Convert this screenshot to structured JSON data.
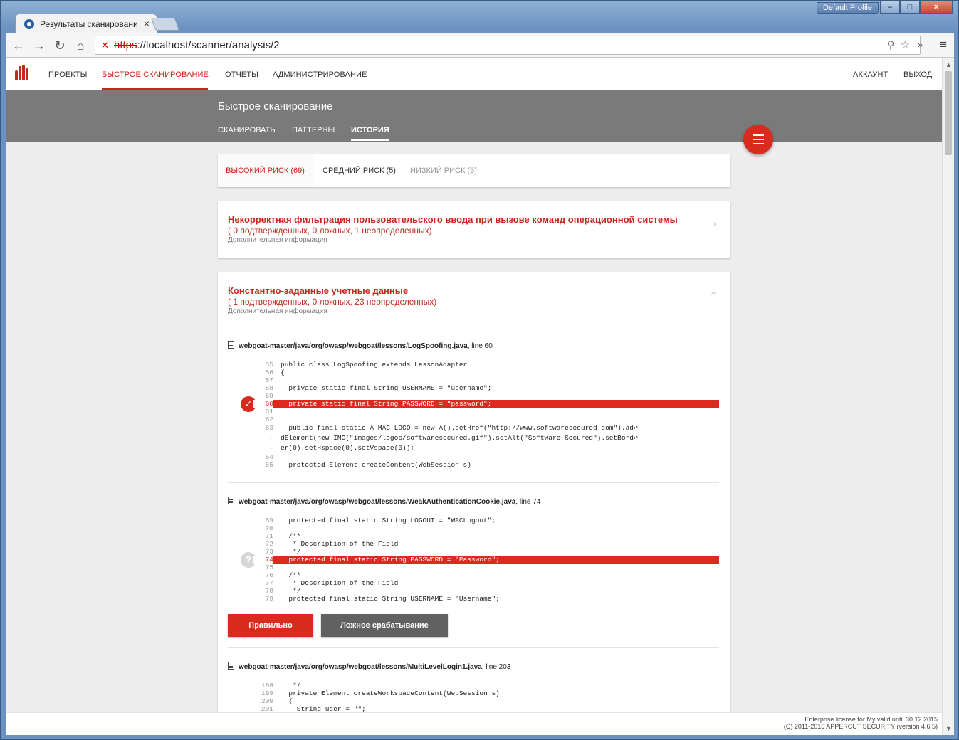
{
  "browser": {
    "tab_title": "Результаты сканировани",
    "tab_close": "×",
    "profile": "Default Profile",
    "win_min": "–",
    "win_max": "□",
    "win_close": "×",
    "url_scheme": "https",
    "url_rest": "://localhost/scanner/analysis/2",
    "back": "←",
    "forward": "→",
    "reload": "↻",
    "home": "⌂",
    "more": "»",
    "menu": "≡",
    "omni_icons": "⚲☆"
  },
  "nav": {
    "items": [
      "ПРОЕКТЫ",
      "БЫСТРОЕ СКАНИРОВАНИЕ",
      "ОТЧЕТЫ",
      "АДМИНИСТРИРОВАНИЕ"
    ],
    "account": "АККАУНТ",
    "logout": "ВЫХОД"
  },
  "subheader": {
    "title": "Быстрое сканирование",
    "tabs": [
      "СКАНИРОВАТЬ",
      "ПАТТЕРНЫ",
      "ИСТОРИЯ"
    ]
  },
  "risk_tabs": {
    "high": "ВЫСОКИЙ РИСК (69)",
    "medium": "СРЕДНИЙ РИСК (5)",
    "low": "НИЗКИЙ РИСК (3)"
  },
  "vulns": [
    {
      "title": "Некорректная фильтрация пользовательского ввода при вызове команд операционной системы",
      "counts": "( 0 подтвержденных, 0 ложных, 1 неопределенных)",
      "more": "Дополнительная информация",
      "chevron": "›"
    },
    {
      "title": "Константно-заданные учетные данные",
      "counts": "( 1 подтвержденных, 0 ложных, 23 неопределенных)",
      "more": "Дополнительная информация",
      "chevron": "‹",
      "findings": [
        {
          "path": "webgoat-master/java/org/owasp/webgoat/lessons/LogSpoofing.java",
          "line_label": ", line 60",
          "mark": "✓",
          "code": [
            {
              "ln": "55",
              "tx": "public class LogSpoofing extends LessonAdapter"
            },
            {
              "ln": "56",
              "tx": "{"
            },
            {
              "ln": "57",
              "tx": ""
            },
            {
              "ln": "58",
              "tx": "  private static final String USERNAME = \"username\";"
            },
            {
              "ln": "59",
              "tx": ""
            },
            {
              "ln": "60",
              "tx": "  private static final String PASSWORD = \"password\";"
            },
            {
              "ln": "61",
              "tx": ""
            },
            {
              "ln": "62",
              "tx": ""
            },
            {
              "ln": "63",
              "tx": "  public final static A MAC_LOGO = new A().setHref(\"http://www.softwaresecured.com\").ad↩"
            },
            {
              "ln": "—",
              "tx": "dElement(new IMG(\"images/logos/softwaresecured.gif\").setAlt(\"Software Secured\").setBord↩"
            },
            {
              "ln": "—",
              "tx": "er(0).setHspace(0).setVspace(0));"
            },
            {
              "ln": "64",
              "tx": ""
            },
            {
              "ln": "65",
              "tx": "  protected Element createContent(WebSession s)"
            }
          ]
        },
        {
          "path": "webgoat-master/java/org/owasp/webgoat/lessons/WeakAuthenticationCookie.java",
          "line_label": ", line 74",
          "mark": "?",
          "code": [
            {
              "ln": "69",
              "tx": "  protected final static String LOGOUT = \"WACLogout\";"
            },
            {
              "ln": "70",
              "tx": ""
            },
            {
              "ln": "71",
              "tx": "  /**"
            },
            {
              "ln": "72",
              "tx": "   * Description of the Field"
            },
            {
              "ln": "73",
              "tx": "   */"
            },
            {
              "ln": "74",
              "tx": "  protected final static String PASSWORD = \"Password\";"
            },
            {
              "ln": "75",
              "tx": ""
            },
            {
              "ln": "76",
              "tx": "  /**"
            },
            {
              "ln": "77",
              "tx": "   * Description of the Field"
            },
            {
              "ln": "78",
              "tx": "   */"
            },
            {
              "ln": "79",
              "tx": "  protected final static String USERNAME = \"Username\";"
            }
          ],
          "btn_correct": "Правильно",
          "btn_false": "Ложное срабатывание"
        },
        {
          "path": "webgoat-master/java/org/owasp/webgoat/lessons/MultiLevelLogin1.java",
          "line_label": ", line 203",
          "code": [
            {
              "ln": "198",
              "tx": "   */"
            },
            {
              "ln": "199",
              "tx": "  private Element createWorkspaceContent(WebSession s)"
            },
            {
              "ln": "200",
              "tx": "  {"
            },
            {
              "ln": "201",
              "tx": "    String user = \"\";"
            }
          ]
        }
      ]
    }
  ],
  "fab_icon": "menu-icon",
  "footer": {
    "line1": "Enterprise license for My valid until 30.12.2015",
    "line2": "(C) 2011-2015 APPERCUT SECURITY (version 4.6.5)"
  },
  "colors": {
    "accent": "#d92a1e",
    "header_bg": "#7a7a7a",
    "page_bg": "#ededed"
  }
}
